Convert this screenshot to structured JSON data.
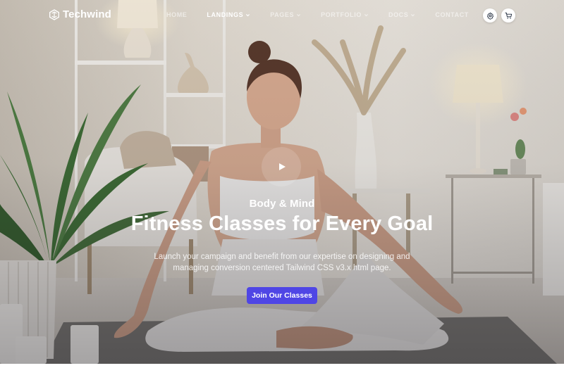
{
  "brand": {
    "name": "Techwind",
    "logo_icon": "hexagon-logo-icon"
  },
  "nav": {
    "items": [
      {
        "label": "HOME",
        "active": false,
        "has_dropdown": false
      },
      {
        "label": "LANDINGS",
        "active": true,
        "has_dropdown": true
      },
      {
        "label": "PAGES",
        "active": false,
        "has_dropdown": true
      },
      {
        "label": "PORTFOLIO",
        "active": false,
        "has_dropdown": true
      },
      {
        "label": "DOCS",
        "active": false,
        "has_dropdown": true
      },
      {
        "label": "CONTACT",
        "active": false,
        "has_dropdown": false
      }
    ],
    "actions": [
      {
        "icon": "gear-icon"
      },
      {
        "icon": "cart-icon"
      }
    ]
  },
  "hero": {
    "eyebrow": "Body & Mind",
    "title": "Fitness Classes for Every Goal",
    "description_line1": "Launch your campaign and benefit from our expertise on designing and",
    "description_line2": "managing conversion centered Tailwind CSS v3.x html page.",
    "cta_label": "Join Our Classes",
    "play_icon": "play-icon"
  },
  "colors": {
    "accent": "#4f46e5",
    "text_on_image": "#ffffff"
  }
}
